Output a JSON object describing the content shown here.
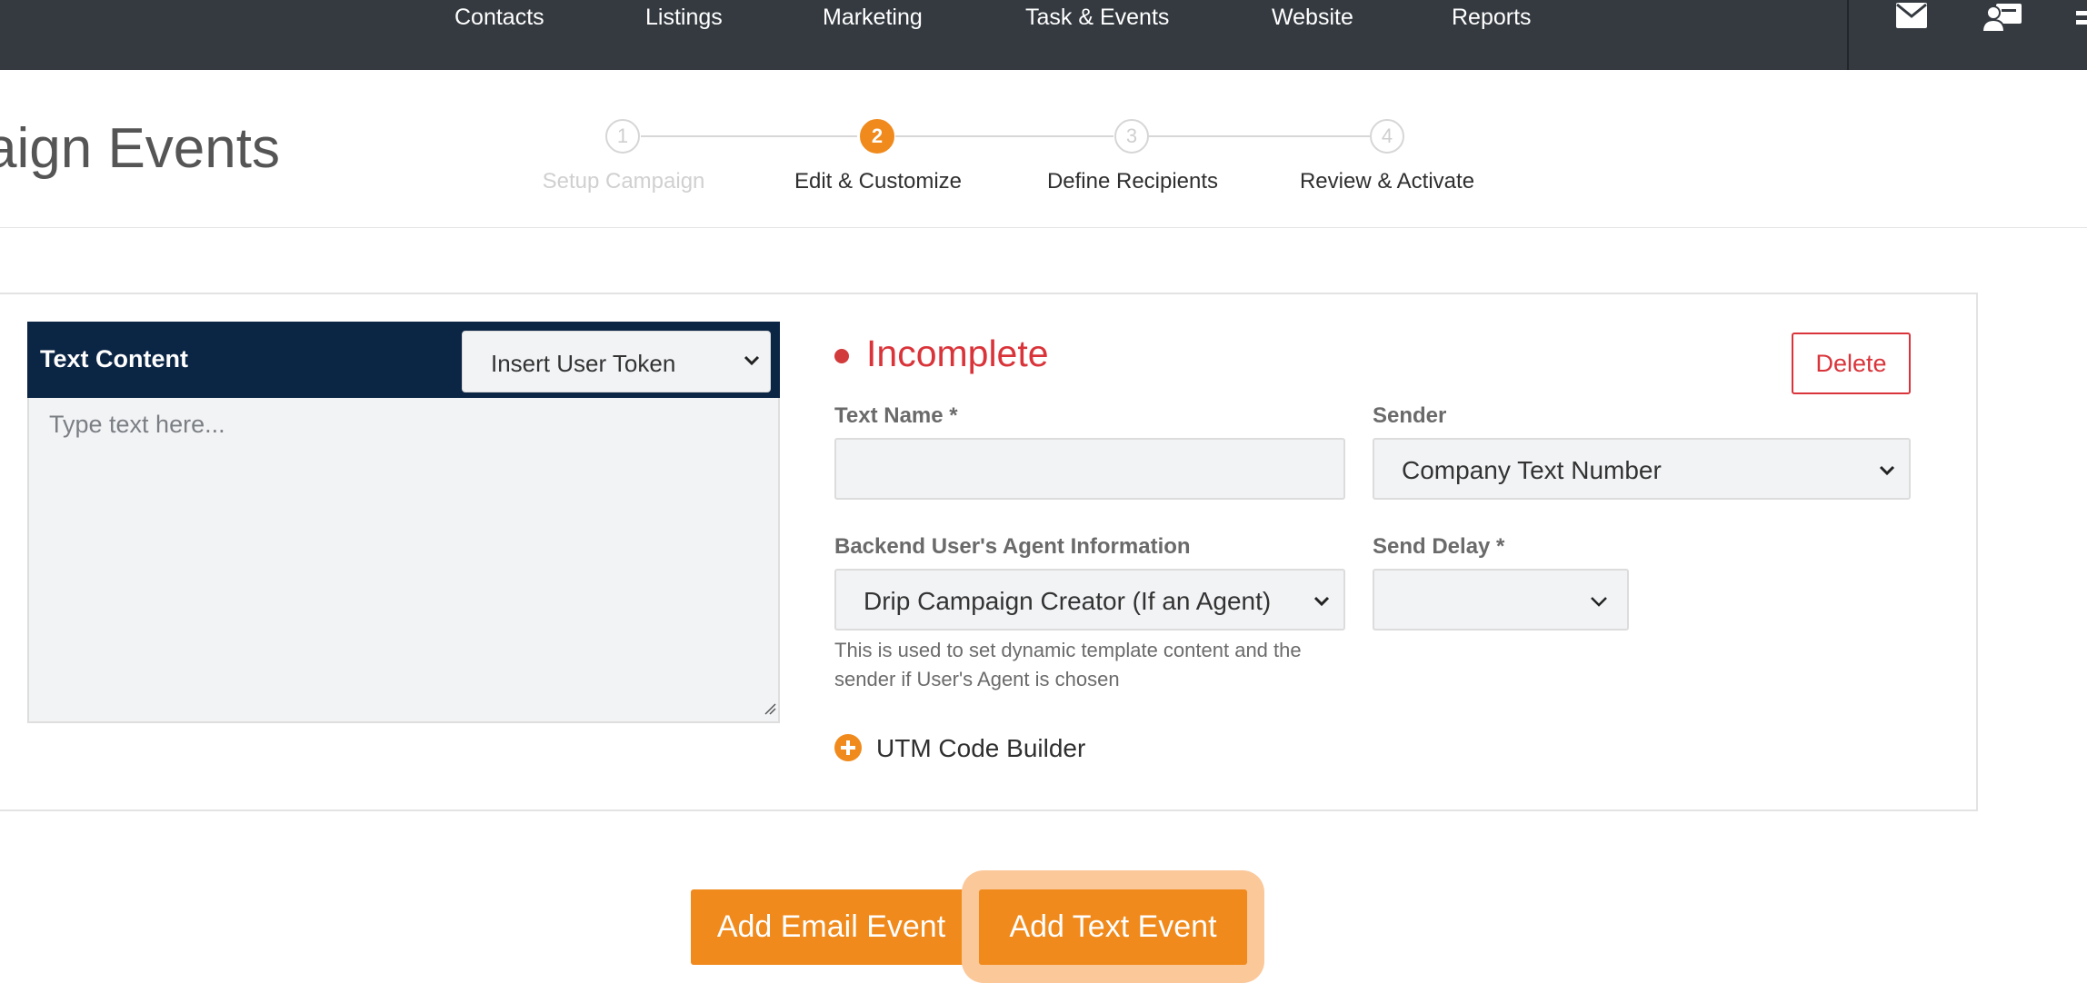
{
  "nav": {
    "items": [
      "Contacts",
      "Listings",
      "Marketing",
      "Task & Events",
      "Website",
      "Reports"
    ],
    "icons": [
      "envelope-icon",
      "contact-card-icon"
    ]
  },
  "page": {
    "title": "aign Events"
  },
  "stepper": {
    "current": 2,
    "steps": [
      {
        "number": "1",
        "label": "Setup Campaign",
        "state": "disabled"
      },
      {
        "number": "2",
        "label": "Edit & Customize",
        "state": "active"
      },
      {
        "number": "3",
        "label": "Define Recipients",
        "state": "upcoming"
      },
      {
        "number": "4",
        "label": "Review & Activate",
        "state": "upcoming"
      }
    ]
  },
  "text_content": {
    "title": "Text Content",
    "token_select": "Insert User Token",
    "placeholder": "Type text here..."
  },
  "form": {
    "status": "Incomplete",
    "delete_label": "Delete",
    "text_name_label": "Text Name *",
    "text_name_value": "",
    "sender_label": "Sender",
    "sender_value": "Company Text Number",
    "agent_info_label": "Backend User's Agent Information",
    "agent_info_value": "Drip Campaign Creator (If an Agent)",
    "send_delay_label": "Send Delay *",
    "send_delay_value": "",
    "help_text": "This is used to set dynamic template content and the sender if User's Agent is chosen",
    "utm_label": "UTM Code Builder"
  },
  "actions": {
    "add_email": "Add Email Event",
    "add_text": "Add Text Event"
  },
  "colors": {
    "nav_bg": "#343a40",
    "accent": "#f08a1c",
    "panel_header": "#0b2545",
    "danger": "#d9343a"
  }
}
